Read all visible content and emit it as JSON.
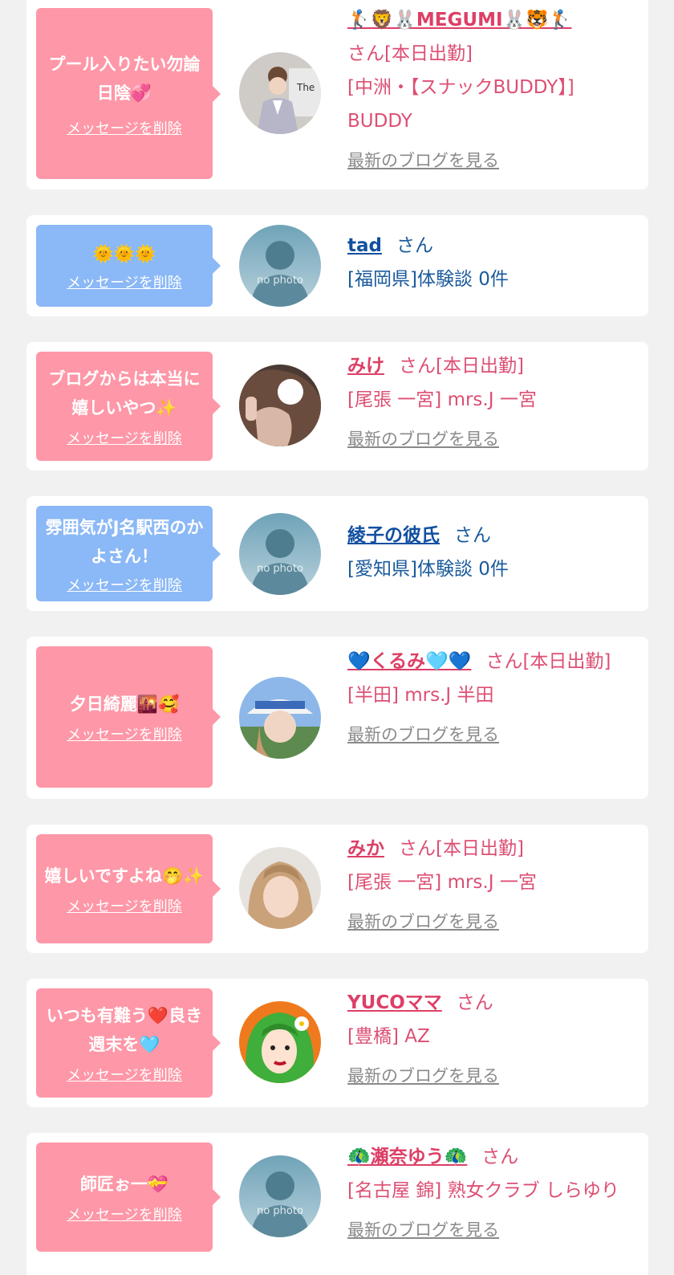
{
  "colors": {
    "pink_bubble": "#fe97a7",
    "blue_bubble": "#8bb8f6",
    "pink_text": "#dd4f73",
    "blue_text": "#1a5a9c",
    "blog_link": "#8a8a8a",
    "background": "#f1f1f1"
  },
  "items": [
    {
      "bubble_color": "pink",
      "message": "プール入りたい勿論日陰💞",
      "delete_label": "メッセージを削除",
      "name": "🏌️🦁🐰MEGUMI🐰🐯🏌️",
      "suffix": "さん[本日出勤]",
      "shop": "[中洲・【スナックBUDDY】] BUDDY",
      "blog_label": "最新のブログを見る",
      "avatar": "photo-kimono-woman"
    },
    {
      "bubble_color": "blue",
      "message": "🌞🌞🌞",
      "delete_label": "メッセージを削除",
      "name": "tad",
      "suffix": "さん",
      "shop": "[福岡県]体験談 0件",
      "avatar": "no-photo",
      "avatar_text": "no photo"
    },
    {
      "bubble_color": "pink",
      "message": "ブログからは本当に嬉しいやつ✨",
      "delete_label": "メッセージを削除",
      "name": "みけ",
      "suffix": "さん[本日出勤]",
      "shop": "[尾張 一宮] mrs.J 一宮",
      "blog_label": "最新のブログを見る",
      "avatar": "photo-woman-peace"
    },
    {
      "bubble_color": "blue",
      "message": "雰囲気がJ名駅西のかよさん！",
      "delete_label": "メッセージを削除",
      "name": "綾子の彼氏",
      "suffix": "さん",
      "shop": "[愛知県]体験談 0件",
      "avatar": "no-photo",
      "avatar_text": "no photo"
    },
    {
      "bubble_color": "pink",
      "message": "夕日綺麗🌇🥰",
      "delete_label": "メッセージを削除",
      "name": "💙くるみ🩵💙",
      "suffix": "さん[本日出勤]",
      "shop": "[半田] mrs.J 半田",
      "blog_label": "最新のブログを見る",
      "avatar": "photo-woman-cap"
    },
    {
      "bubble_color": "pink",
      "message": "嬉しいですよね🤭✨",
      "delete_label": "メッセージを削除",
      "name": "みか",
      "suffix": "さん[本日出勤]",
      "shop": "[尾張 一宮] mrs.J 一宮",
      "blog_label": "最新のブログを見る",
      "avatar": "photo-woman-blonde"
    },
    {
      "bubble_color": "pink",
      "message": "いつも有難う❤️良き週末を🩵",
      "delete_label": "メッセージを削除",
      "name": "YUCOママ",
      "suffix": "さん",
      "shop": "[豊橋] AZ",
      "blog_label": "最新のブログを見る",
      "avatar": "illustration-green-hair"
    },
    {
      "bubble_color": "pink",
      "message": "師匠ぉ一💝",
      "delete_label": "メッセージを削除",
      "name": "🦚瀬奈ゆう🦚",
      "suffix": "さん",
      "shop": "[名古屋 錦] 熟女クラブ しらゆり",
      "blog_label": "最新のブログを見る",
      "avatar": "no-photo",
      "avatar_text": "no photo"
    }
  ]
}
